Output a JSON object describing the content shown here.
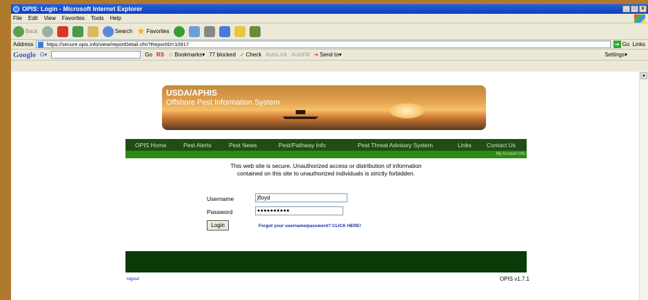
{
  "window": {
    "title": "OPIS: Login - Microsoft Internet Explorer",
    "controls": [
      "_",
      "□",
      "x"
    ]
  },
  "menu": [
    "File",
    "Edit",
    "View",
    "Favorites",
    "Tools",
    "Help"
  ],
  "toolbar": {
    "back": "Back",
    "search": "Search",
    "favorites": "Favorites"
  },
  "address": {
    "label": "Address",
    "url": "https://secure.opis.info/view/reportDetail.cfm?ReportID=10917",
    "go": "Go",
    "links": "Links"
  },
  "googlebar": {
    "logo": "Google",
    "g_label": "G▾",
    "go": "Go",
    "rs": "RS",
    "bookmarks": "Bookmarks▾",
    "blocked": "77 blocked",
    "check": "Check",
    "autolink": "AutoLink",
    "autofill": "AutoFill",
    "sendto": "Send to▾",
    "settings": "Settings▾"
  },
  "banner": {
    "title1": "USDA/APHIS",
    "title2": "Offshore Pest Information System"
  },
  "nav": {
    "items": [
      "OPIS Home",
      "Pest Alerts",
      "Pest News",
      "Pest/Pathway Info",
      "Pest Threat Advisory System",
      "Links",
      "Contact Us"
    ],
    "my_account": "My Account Info"
  },
  "notice": {
    "line1": "This web site is secure. Unauthorized access or distribution of information",
    "line2": "contained on this site to unauthorized individuals is strictly forbidden."
  },
  "form": {
    "username_label": "Username",
    "username_value": "jfloyd",
    "password_label": "Password",
    "password_value": "●●●●●●●●●●",
    "login": "Login",
    "forgot": "Forgot your username/password? CLICK HERE!"
  },
  "footer": {
    "logout": "logout",
    "version": "OPIS v1.7.1"
  },
  "colors": {
    "nav_dark": "#1f4d16",
    "nav_bright": "#2b8a12",
    "footer": "#0a3a08",
    "link": "#1a2aa8"
  }
}
